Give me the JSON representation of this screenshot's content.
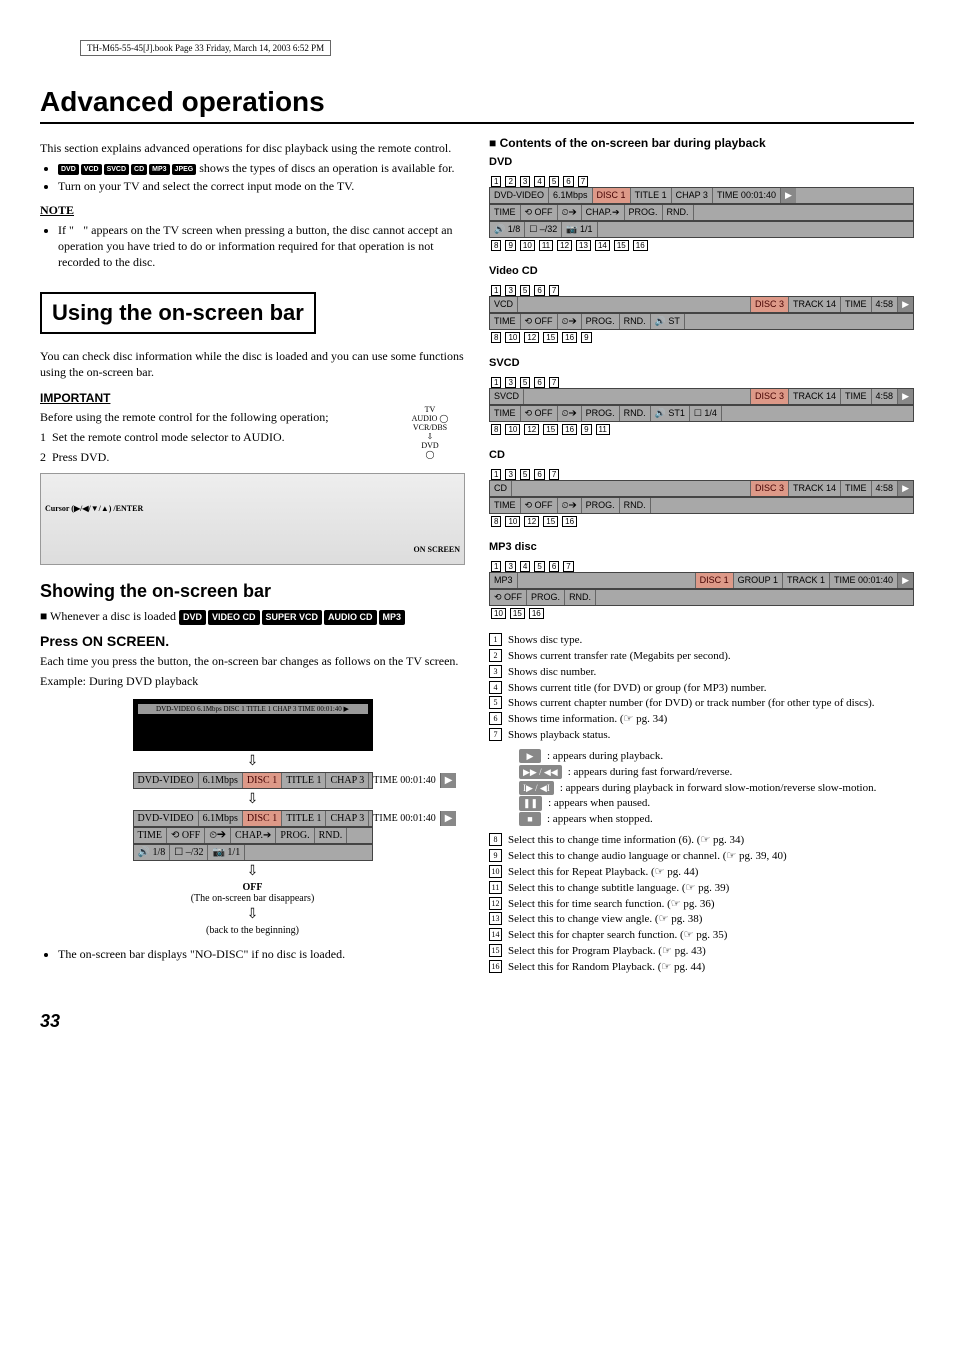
{
  "meta": {
    "header": "TH-M65-55-45[J].book  Page 33  Friday, March 14, 2003  6:52 PM"
  },
  "title": "Advanced operations",
  "intro": {
    "p1": "This section explains advanced operations for disc playback using the remote control.",
    "bullet_badges": "shows the types of discs an operation is available for.",
    "bullet_tv": "Turn on your TV and select the correct input mode on the TV."
  },
  "note": {
    "head": "NOTE",
    "text": "If \"⃠\" appears on the TV screen when pressing a button, the disc cannot accept an operation you have tried to do or information required for that operation is not recorded to the disc."
  },
  "section1": {
    "box": "Using the on-screen bar",
    "p1": "You can check disc information while the disc is loaded and you can use some functions using the on-screen bar.",
    "important": "IMPORTANT",
    "before": "Before using the remote control for the following operation;",
    "step1": "Set the remote control mode selector to AUDIO.",
    "step2": "Press DVD.",
    "selector_labels": {
      "tv": "TV",
      "audio": "AUDIO",
      "vcr": "VCR/DBS",
      "dvd": "DVD"
    },
    "diagram": {
      "cursor": "Cursor (▶/◀/▼/▲) /ENTER",
      "onscreen": "ON SCREEN"
    }
  },
  "showing": {
    "h2": "Showing the on-screen bar",
    "whenever": "Whenever a disc is loaded",
    "badges": [
      "DVD",
      "VIDEO CD",
      "SUPER VCD",
      "AUDIO CD",
      "MP3"
    ],
    "press": "Press ON SCREEN.",
    "p1": "Each time you press the button, the on-screen bar changes as follows on the TV screen.",
    "example": "Example: During DVD playback",
    "off": "OFF",
    "off_sub": "(The on-screen bar disappears)",
    "back": "(back to the beginning)",
    "nodisc": "The on-screen bar displays \"NO-DISC\" if no disc is loaded."
  },
  "contents": {
    "head": "■ Contents of the on-screen bar during playback",
    "dvd": {
      "label": "DVD",
      "row1": [
        "DVD-VIDEO",
        "6.1Mbps",
        "DISC 1",
        "TITLE  1",
        "CHAP  3",
        "TIME 00:01:40",
        "▶"
      ],
      "row2": [
        "TIME",
        "⟲ OFF",
        "⏲➔",
        "CHAP.➔",
        "PROG.",
        "RND."
      ],
      "row3": [
        "🔊 1/8",
        "☐ –/32",
        "📷 1/1"
      ],
      "callouts_top": [
        "1",
        "2",
        "3",
        "4",
        "5",
        "6",
        "7"
      ],
      "callouts_bottom": [
        "8",
        "9",
        "10",
        "11",
        "12",
        "13",
        "14",
        "15",
        "16"
      ]
    },
    "vcd": {
      "label": "Video CD",
      "row1": [
        "VCD",
        "DISC 3",
        "TRACK 14",
        "TIME",
        "4:58",
        "▶"
      ],
      "row2": [
        "TIME",
        "⟲ OFF",
        "⏲➔",
        "PROG.",
        "RND.",
        "🔊 ST"
      ],
      "callouts_top": [
        "1",
        "3",
        "5",
        "6",
        "7"
      ],
      "callouts_bottom": [
        "8",
        "10",
        "12",
        "15",
        "16",
        "9"
      ]
    },
    "svcd": {
      "label": "SVCD",
      "row1": [
        "SVCD",
        "DISC 3",
        "TRACK 14",
        "TIME",
        "4:58",
        "▶"
      ],
      "row2": [
        "TIME",
        "⟲ OFF",
        "⏲➔",
        "PROG.",
        "RND.",
        "🔊 ST1",
        "☐  1/4"
      ],
      "callouts_top": [
        "1",
        "3",
        "5",
        "6",
        "7"
      ],
      "callouts_bottom": [
        "8",
        "10",
        "12",
        "15",
        "16",
        "9",
        "11"
      ]
    },
    "cd": {
      "label": "CD",
      "row1": [
        "CD",
        "DISC 3",
        "TRACK 14",
        "TIME",
        "4:58",
        "▶"
      ],
      "row2": [
        "TIME",
        "⟲ OFF",
        "⏲➔",
        "PROG.",
        "RND."
      ],
      "callouts_top": [
        "1",
        "3",
        "5",
        "6",
        "7"
      ],
      "callouts_bottom": [
        "8",
        "10",
        "12",
        "15",
        "16"
      ]
    },
    "mp3": {
      "label": "MP3 disc",
      "row1": [
        "MP3",
        "DISC 1",
        "GROUP  1",
        "TRACK  1",
        "TIME 00:01:40",
        "▶"
      ],
      "row2": [
        "⟲ OFF",
        "PROG.",
        "RND."
      ],
      "callouts_top": [
        "1",
        "3",
        "4",
        "5",
        "6",
        "7"
      ],
      "callouts_bottom": [
        "10",
        "15",
        "16"
      ]
    }
  },
  "legend": {
    "items": [
      {
        "n": "1",
        "t": "Shows disc type."
      },
      {
        "n": "2",
        "t": "Shows current transfer rate (Megabits per second)."
      },
      {
        "n": "3",
        "t": "Shows disc number."
      },
      {
        "n": "4",
        "t": "Shows current title (for DVD) or group (for MP3) number."
      },
      {
        "n": "5",
        "t": "Shows current chapter number (for DVD) or track number (for other type of discs)."
      },
      {
        "n": "6",
        "t": "Shows time information. (☞ pg. 34)"
      },
      {
        "n": "7",
        "t": "Shows playback status."
      }
    ],
    "status": [
      {
        "icon": "▶",
        "t": "appears during playback."
      },
      {
        "icon": "▶▶ / ◀◀",
        "t": "appears during fast forward/reverse."
      },
      {
        "icon": "I▶ / ◀I",
        "t": "appears during playback in forward slow-motion/reverse slow-motion."
      },
      {
        "icon": "❚❚",
        "t": "appears when paused."
      },
      {
        "icon": "■",
        "t": "appears when stopped."
      }
    ],
    "items2": [
      {
        "n": "8",
        "t": "Select this to change time information (6). (☞ pg. 34)"
      },
      {
        "n": "9",
        "t": "Select this to change audio language or channel. (☞ pg. 39, 40)"
      },
      {
        "n": "10",
        "t": "Select this for Repeat Playback. (☞ pg. 44)"
      },
      {
        "n": "11",
        "t": "Select this to change subtitle language. (☞ pg. 39)"
      },
      {
        "n": "12",
        "t": "Select this for time search function. (☞ pg. 36)"
      },
      {
        "n": "13",
        "t": "Select this to change view angle. (☞ pg. 38)"
      },
      {
        "n": "14",
        "t": "Select this for chapter search function. (☞ pg. 35)"
      },
      {
        "n": "15",
        "t": "Select this for Program Playback. (☞ pg. 43)"
      },
      {
        "n": "16",
        "t": "Select this for Random Playback. (☞ pg. 44)"
      }
    ]
  },
  "page_number": "33"
}
